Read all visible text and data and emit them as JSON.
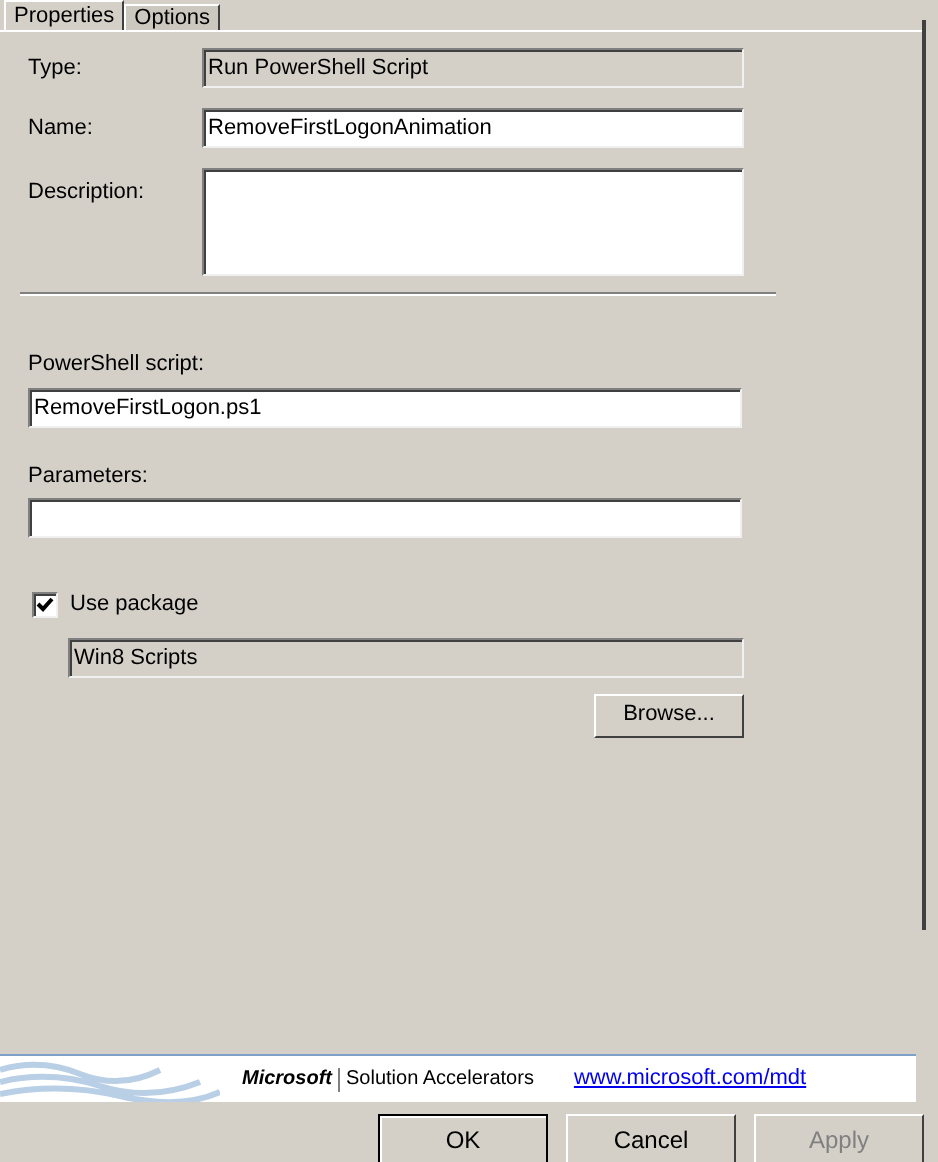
{
  "tabs": [
    {
      "label": "Properties",
      "selected": true
    },
    {
      "label": "Options",
      "selected": false
    }
  ],
  "type": {
    "label": "Type:",
    "value": "Run PowerShell Script",
    "disabled": true
  },
  "name": {
    "label": "Name:",
    "value": "RemoveFirstLogonAnimation"
  },
  "description": {
    "label": "Description:"
  },
  "script": {
    "label": "PowerShell script:",
    "value": "RemoveFirstLogon.ps1"
  },
  "parameters": {
    "label": "Parameters:"
  },
  "use_package": {
    "label": "Use package",
    "checked": true
  },
  "package": {
    "value": "Win8 Scripts",
    "disabled": true
  },
  "browse_button": "Browse...",
  "banner": {
    "brand": "Microsoft",
    "product": "Solution Accelerators",
    "link": "www.microsoft.com/mdt"
  },
  "buttons": [
    {
      "label": "OK",
      "default": true,
      "disabled": false
    },
    {
      "label": "Cancel",
      "default": false,
      "disabled": false
    },
    {
      "label": "Apply",
      "default": false,
      "disabled": true
    }
  ]
}
